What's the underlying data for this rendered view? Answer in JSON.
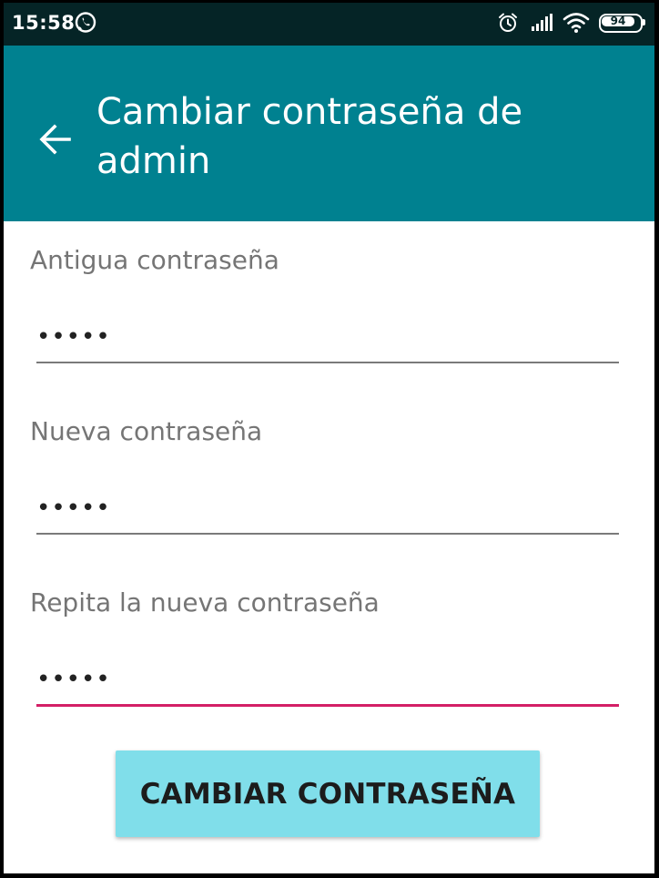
{
  "status_bar": {
    "time": "15:58",
    "battery_level": "94",
    "icons": [
      "whatsapp-icon",
      "alarm-icon",
      "signal-icon",
      "wifi-icon",
      "battery-icon"
    ]
  },
  "app_bar": {
    "title": "Cambiar contraseña de admin",
    "back_icon": "arrow-left-icon",
    "background_color": "#008190"
  },
  "form": {
    "fields": [
      {
        "label": "Antigua contraseña",
        "value": "•••••",
        "focused": false
      },
      {
        "label": "Nueva contraseña",
        "value": "•••••",
        "focused": false
      },
      {
        "label": "Repita la nueva contraseña",
        "value": "•••••",
        "focused": true
      }
    ],
    "submit_label": "CAMBIAR CONTRASEÑA"
  },
  "colors": {
    "accent": "#d31f66",
    "button": "#80deea",
    "status_bar": "#052426"
  }
}
